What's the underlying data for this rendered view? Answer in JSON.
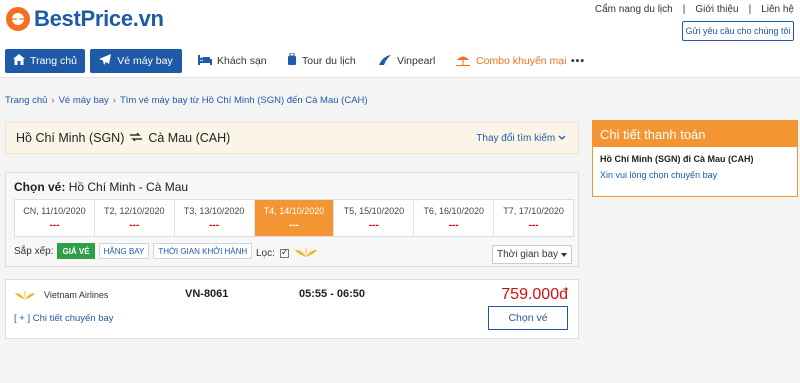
{
  "brand": {
    "name": "BestPrice.vn",
    "color": "#1e5aa8",
    "accent": "#f36f21"
  },
  "toplinks": [
    "Cẩm nang du lịch",
    "Giới thiệu",
    "Liên hệ"
  ],
  "request_button": "Gửi yêu cầu cho chúng tôi",
  "nav": {
    "items": [
      {
        "label": "Trang chủ",
        "icon": "home-icon"
      },
      {
        "label": "Vé máy bay",
        "icon": "plane-icon"
      },
      {
        "label": "Khách sạn",
        "icon": "bed-icon"
      },
      {
        "label": "Tour du lịch",
        "icon": "luggage-icon"
      },
      {
        "label": "Vinpearl",
        "icon": "vinpearl-icon"
      },
      {
        "label": "Combo khuyến mại",
        "icon": "beach-icon"
      }
    ],
    "more": "•••"
  },
  "breadcrumb": [
    "Trang chủ",
    "Vé máy bay",
    "Tìm vé máy bay từ Hồ Chí Minh (SGN) đến Cà Mau (CAH)"
  ],
  "route": {
    "from": "Hồ Chí Minh (SGN)",
    "to": "Cà Mau (CAH)",
    "change": "Thay đổi tìm kiếm"
  },
  "choose": {
    "label": "Chọn vé:",
    "route": "Hồ Chí Minh - Cà Mau",
    "dates": [
      {
        "label": "CN, 11/10/2020",
        "price": "---",
        "active": false
      },
      {
        "label": "T2, 12/10/2020",
        "price": "---",
        "active": false
      },
      {
        "label": "T3, 13/10/2020",
        "price": "---",
        "active": false
      },
      {
        "label": "T4, 14/10/2020",
        "price": "---",
        "active": true
      },
      {
        "label": "T5, 15/10/2020",
        "price": "---",
        "active": false
      },
      {
        "label": "T6, 16/10/2020",
        "price": "---",
        "active": false
      },
      {
        "label": "T7, 17/10/2020",
        "price": "---",
        "active": false
      }
    ],
    "sort_label": "Sắp xếp:",
    "sort_options": [
      "GIÁ VÉ",
      "HÃNG BAY",
      "THỜI GIAN KHỞI HÀNH"
    ],
    "filter_label": "Lọc:",
    "time_sort": "Thời gian bay"
  },
  "result": {
    "airline": "Vietnam Airlines",
    "detail": "[ + ] Chi tiết chuyến bay",
    "code": "VN-8061",
    "times": "05:55 - 06:50",
    "price": "759.000đ",
    "select": "Chọn vé"
  },
  "payment": {
    "title": "Chi tiết thanh toán",
    "route": "Hồ Chí Minh (SGN) đi Cà Mau (CAH)",
    "hint": "Xin vui lòng chọn chuyến bay"
  }
}
